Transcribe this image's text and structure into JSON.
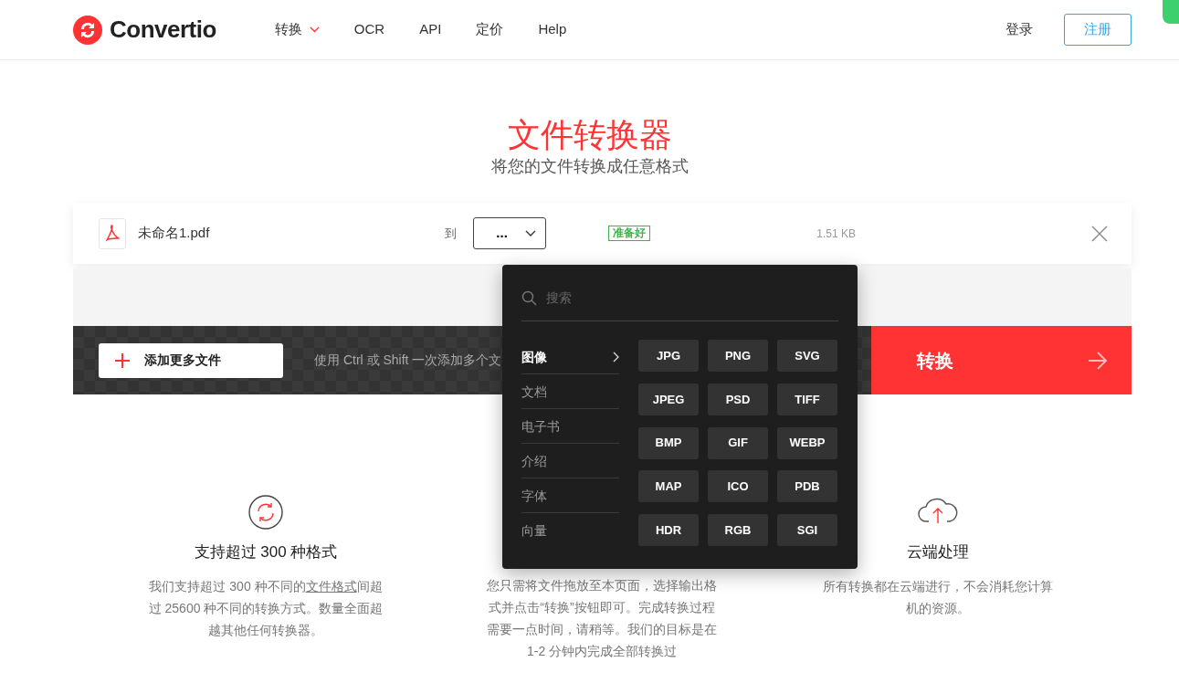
{
  "header": {
    "logo": "Convertio",
    "nav": [
      {
        "label": "转换",
        "dropdown": true
      },
      {
        "label": "OCR",
        "dropdown": false
      },
      {
        "label": "API",
        "dropdown": false
      },
      {
        "label": "定价",
        "dropdown": false
      },
      {
        "label": "Help",
        "dropdown": false
      }
    ],
    "login": "登录",
    "signup": "注册"
  },
  "hero": {
    "title": "文件转换器",
    "subtitle": "将您的文件转换成任意格式"
  },
  "file": {
    "name": "未命名1.pdf",
    "to_label": "到",
    "format": "...",
    "status": "准备好",
    "size": "1.51 KB"
  },
  "actions": {
    "add_button": "添加更多文件",
    "hint": "使用 Ctrl 或 Shift 一次添加多个文",
    "convert_button": "转换"
  },
  "format_menu": {
    "placeholder": "搜索",
    "categories": [
      {
        "label": "图像",
        "selected": true
      },
      {
        "label": "文档",
        "selected": false
      },
      {
        "label": "电子书",
        "selected": false
      },
      {
        "label": "介绍",
        "selected": false
      },
      {
        "label": "字体",
        "selected": false
      },
      {
        "label": "向量",
        "selected": false
      }
    ],
    "formats": [
      "JPG",
      "PNG",
      "SVG",
      "JPEG",
      "PSD",
      "TIFF",
      "BMP",
      "GIF",
      "WEBP",
      "MAP",
      "ICO",
      "PDB",
      "HDR",
      "RGB",
      "SGI"
    ]
  },
  "features": [
    {
      "kind": "sync",
      "title": "支持超过 300 种格式",
      "text_before": "我们支持超过 300 种不同的",
      "link": "文件格式",
      "text_after": "间超过 25600 种不同的转换方式。数量全面超越其他任何转换器。"
    },
    {
      "kind": "covered",
      "text_before": "您只需将文件拖放至本页面，选择输出格式并点击“转换”按钮即可。完成转换过程需要一点时间，请稍等。我们的目标是在 1-2 分钟内完成全部转换过"
    },
    {
      "kind": "cloud",
      "title": "云端处理",
      "text_before": "所有转换都在云端进行，不会消耗您计算机的资源。"
    }
  ]
}
